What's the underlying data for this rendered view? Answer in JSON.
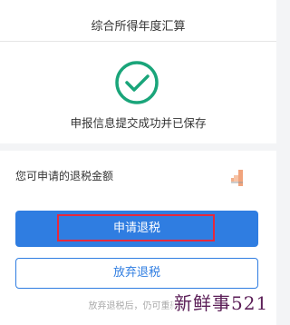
{
  "header": {
    "title": "综合所得年度汇算",
    "status_message": "申报信息提交成功并已保存",
    "status_icon": "check-circle-icon"
  },
  "refund": {
    "label": "您可申请的退税金额"
  },
  "actions": {
    "apply_label": "申请退税",
    "abandon_label": "放弃退税",
    "hint": "放弃退税后，仍可重新发"
  },
  "watermark": "新鲜事521",
  "colors": {
    "accent": "#2f7de1",
    "success": "#1aa57a",
    "highlight": "#e6283c"
  }
}
